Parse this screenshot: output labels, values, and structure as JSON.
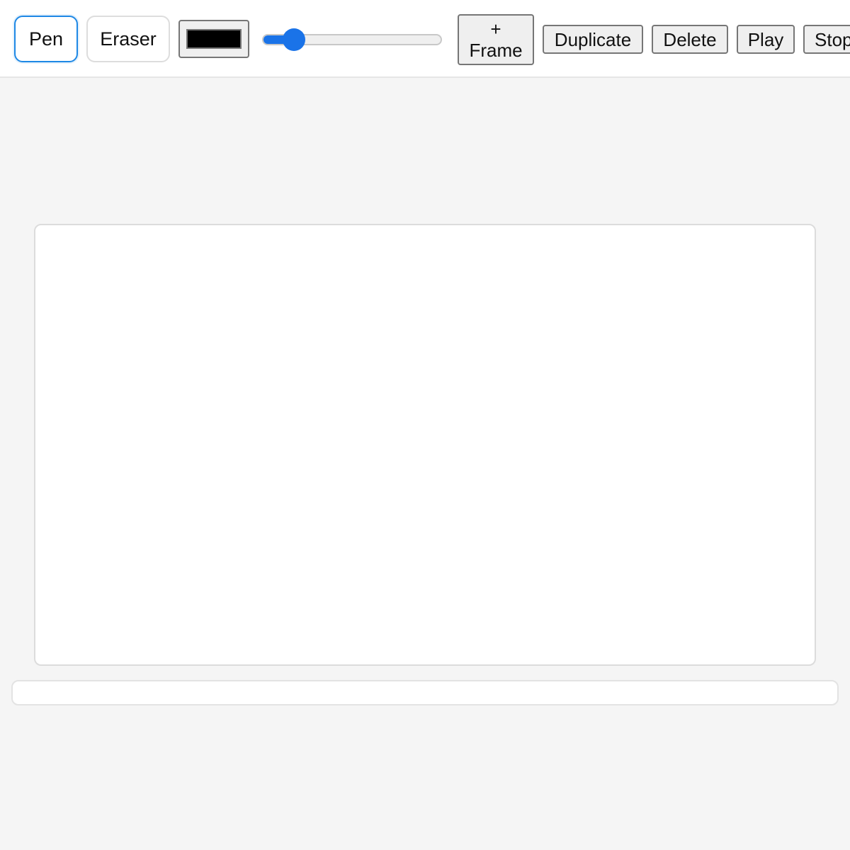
{
  "toolbar": {
    "tools": {
      "pen_label": "Pen",
      "eraser_label": "Eraser",
      "active": "pen"
    },
    "color": {
      "value": "#000000"
    },
    "brush_size": {
      "fraction": 0.13
    },
    "frames": {
      "add_frame_plus": "+",
      "add_frame_label": "Frame",
      "duplicate_label": "Duplicate",
      "delete_label": "Delete"
    },
    "playback": {
      "play_label": "Play",
      "stop_label": "Stop"
    }
  },
  "theme": {
    "accent": "#1a73e8",
    "active_border": "#1e88e5",
    "background": "#f5f5f5"
  }
}
